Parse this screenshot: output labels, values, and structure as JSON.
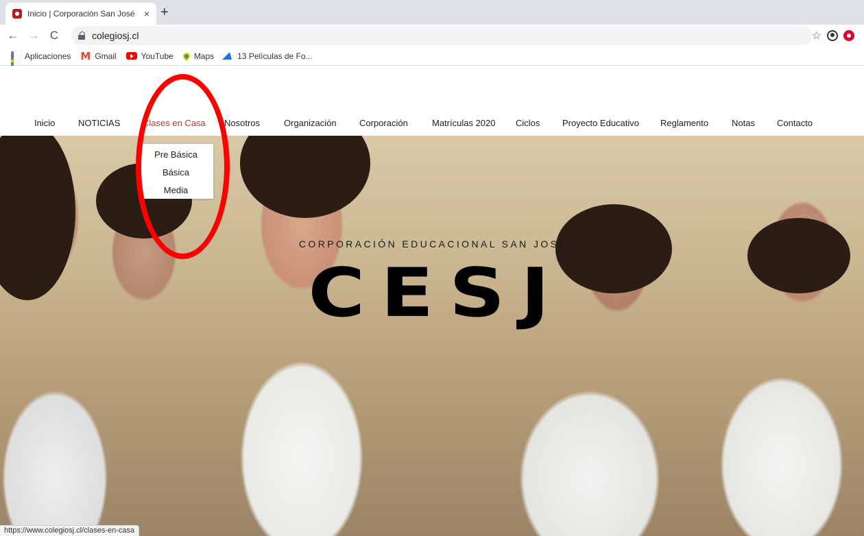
{
  "browser": {
    "tab_title": "Inicio | Corporación San José",
    "tab_close": "×",
    "new_tab": "+",
    "url": "colegiosj.cl",
    "back": "←",
    "forward": "→",
    "reload": "C",
    "star": "☆",
    "bookmarks": [
      {
        "label": "Aplicaciones",
        "icon": "apps-grid-icon"
      },
      {
        "label": "Gmail",
        "icon": "gmail-icon"
      },
      {
        "label": "YouTube",
        "icon": "youtube-icon"
      },
      {
        "label": "Maps",
        "icon": "maps-pin-icon"
      },
      {
        "label": "13 Películas de Fo...",
        "icon": "bookmark-site-icon"
      }
    ],
    "status_url": "https://www.colegiosj.cl/clases-en-casa"
  },
  "site": {
    "nav": [
      {
        "label": "Inicio"
      },
      {
        "label": "NOTICIAS"
      },
      {
        "label": "Clases en Casa",
        "active": true
      },
      {
        "label": "Nosotros"
      },
      {
        "label": "Organización"
      },
      {
        "label": "Corporación"
      },
      {
        "label": "Matrículas 2020"
      },
      {
        "label": "Ciclos"
      },
      {
        "label": "Proyecto Educativo"
      },
      {
        "label": "Reglamento"
      },
      {
        "label": "Notas"
      },
      {
        "label": "Contacto"
      }
    ],
    "dropdown": [
      "Pre Básica",
      "Básica",
      "Media"
    ],
    "hero_subtitle": "CORPORACIÓN EDUCACIONAL SAN JOSÉ",
    "hero_logo": "CESJ"
  },
  "colors": {
    "active_nav": "#c0392b",
    "annotation_circle": "#ff0000"
  }
}
